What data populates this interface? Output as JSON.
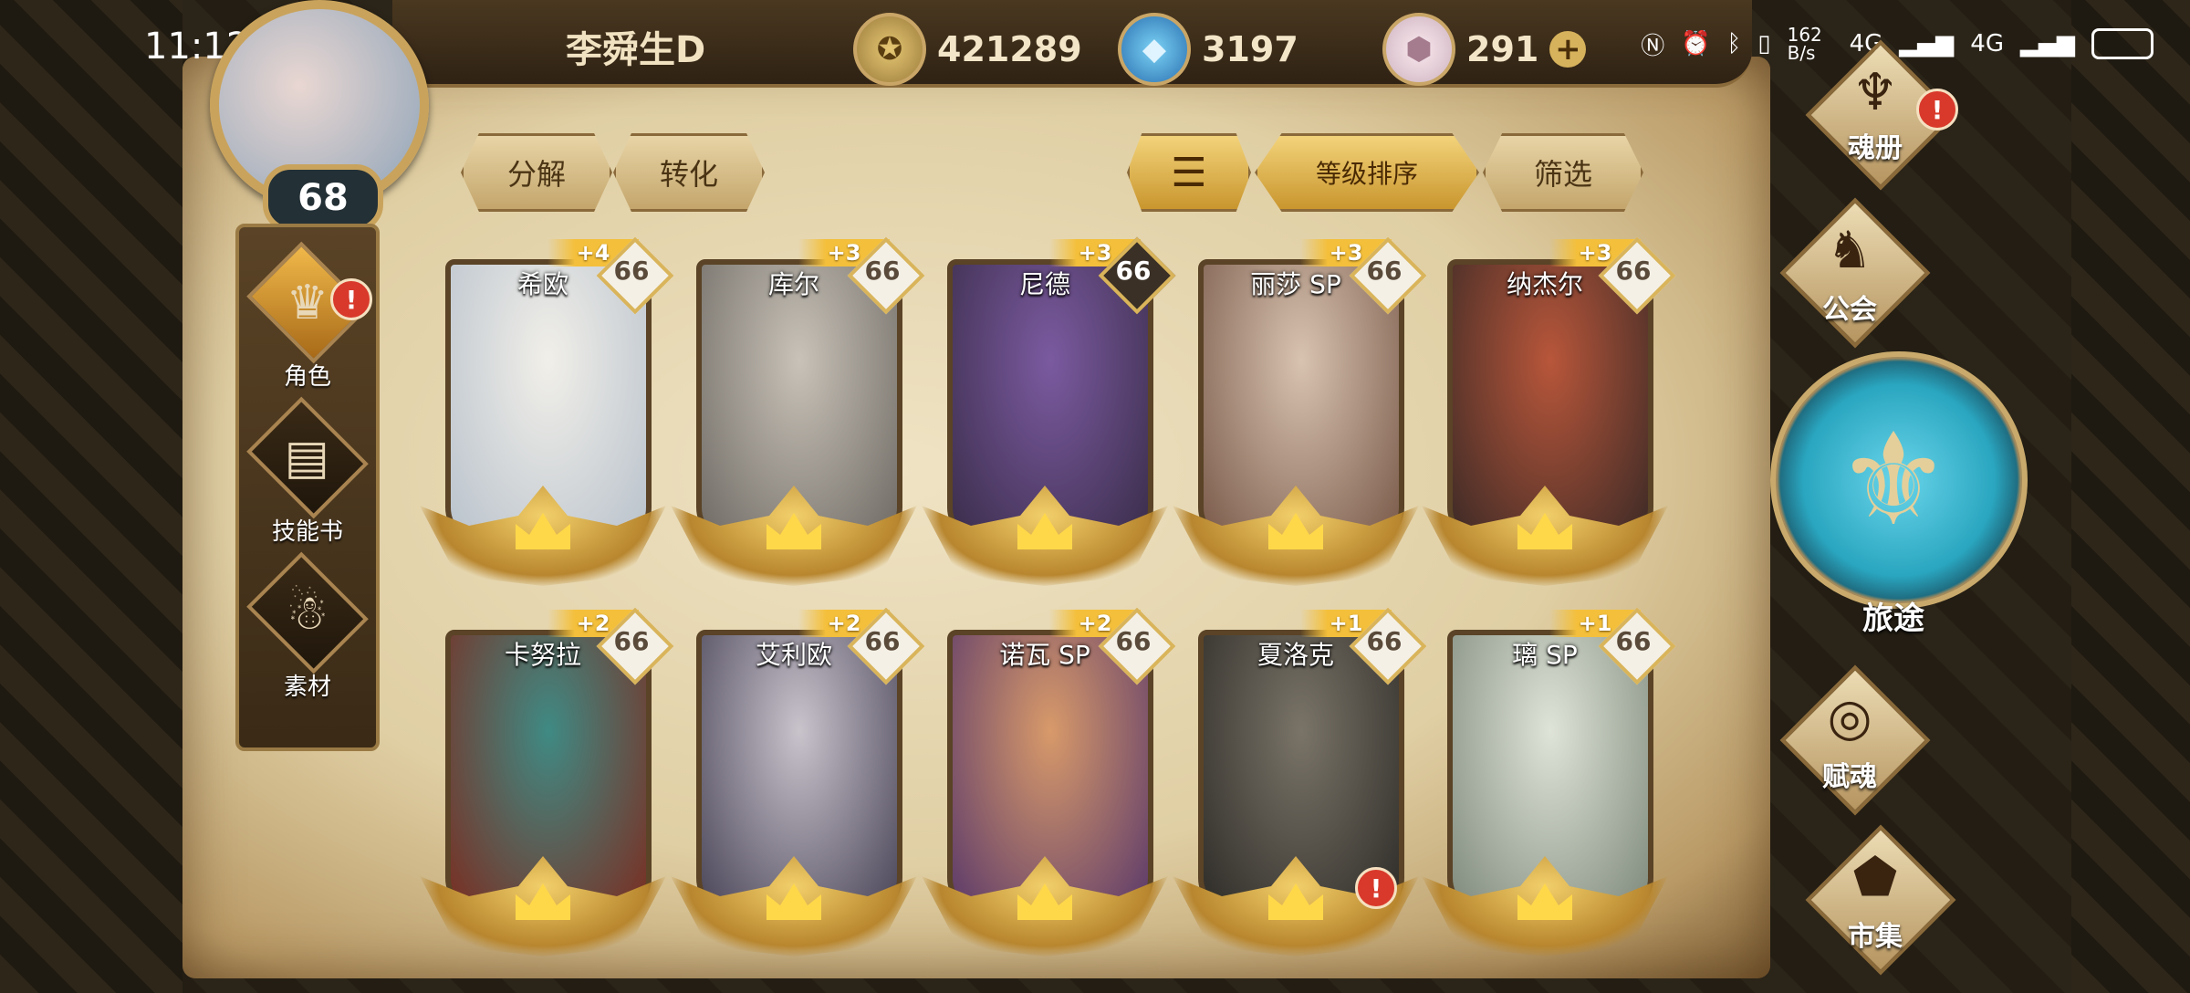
{
  "status_bar": {
    "time": "11:12",
    "net_speed": "162 B/s",
    "signal1": "4G",
    "signal2": "4G"
  },
  "player": {
    "name": "李舜生D",
    "level": "68"
  },
  "currencies": [
    {
      "icon": "gold-coin-icon",
      "value": "421289"
    },
    {
      "icon": "blue-crystal-icon",
      "value": "3197"
    },
    {
      "icon": "gem-icon",
      "value": "291"
    }
  ],
  "left_nav": [
    {
      "label": "角色",
      "icon": "character-icon"
    },
    {
      "label": "技能书",
      "icon": "skill-book-icon"
    },
    {
      "label": "素材",
      "icon": "material-icon"
    }
  ],
  "toolbar": {
    "decompose": "分解",
    "convert": "转化",
    "sort_by_level": "等级排序",
    "filter": "筛选"
  },
  "cards": [
    {
      "name": "希欧",
      "plus": "+4",
      "level": "66"
    },
    {
      "name": "库尔",
      "plus": "+3",
      "level": "66"
    },
    {
      "name": "尼德",
      "plus": "+3",
      "level": "66"
    },
    {
      "name": "丽莎 SP",
      "plus": "+3",
      "level": "66"
    },
    {
      "name": "纳杰尔",
      "plus": "+3",
      "level": "66"
    },
    {
      "name": "卡努拉",
      "plus": "+2",
      "level": "66"
    },
    {
      "name": "艾利欧",
      "plus": "+2",
      "level": "66"
    },
    {
      "name": "诺瓦 SP",
      "plus": "+2",
      "level": "66"
    },
    {
      "name": "夏洛克",
      "plus": "+1",
      "level": "66"
    },
    {
      "name": "璃 SP",
      "plus": "+1",
      "level": "66"
    }
  ],
  "right_nav": {
    "soul_book": "魂册",
    "guild": "公会",
    "journey": "旅途",
    "endow": "赋魂",
    "market": "市集"
  },
  "badge_mark": "!"
}
